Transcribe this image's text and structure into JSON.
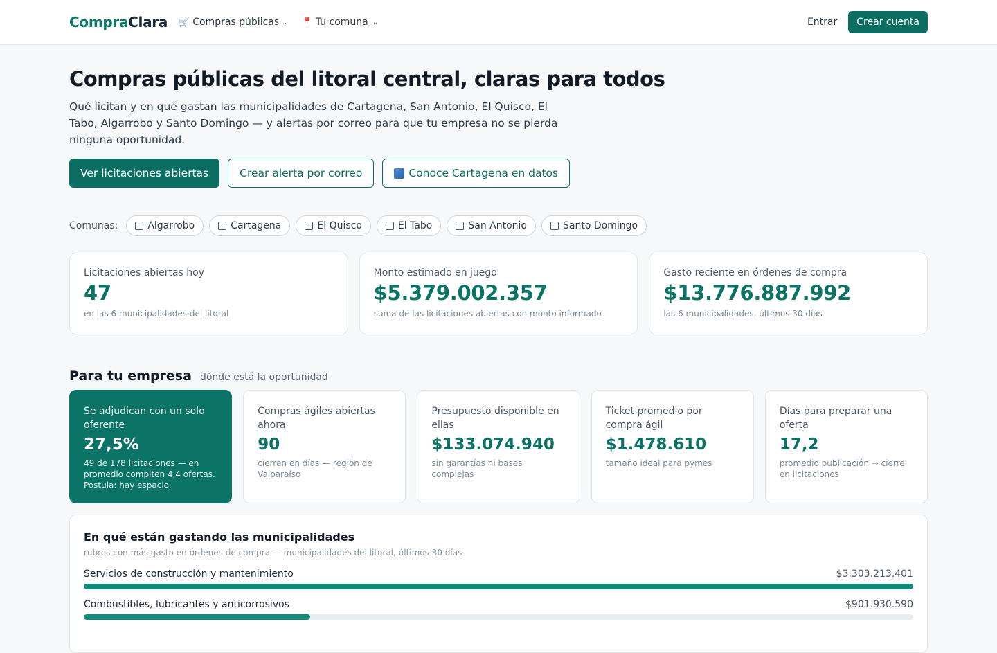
{
  "brand": {
    "part1": "Compra",
    "part2": "Clara"
  },
  "nav": {
    "compras": {
      "icon": "cart-icon",
      "label": "Compras públicas"
    },
    "comuna": {
      "icon": "pin-icon",
      "label": "Tu comuna"
    },
    "login": "Entrar",
    "signup": "Crear cuenta"
  },
  "hero": {
    "title": "Compras públicas del litoral central, claras para todos",
    "subtitle": "Qué licitan y en qué gastan las municipalidades de Cartagena, San Antonio, El Quisco, El Tabo, Algarrobo y Santo Domingo — y alertas por correo para que tu empresa no se pierda ninguna oportunidad.",
    "btn_primary": "Ver licitaciones abiertas",
    "btn_alert": "Crear alerta por correo",
    "btn_datos": "Conoce Cartagena en datos"
  },
  "comunas": {
    "label": "Comunas:",
    "items": [
      "Algarrobo",
      "Cartagena",
      "El Quisco",
      "El Tabo",
      "San Antonio",
      "Santo Domingo"
    ]
  },
  "stats": [
    {
      "label": "Licitaciones abiertas hoy",
      "value": "47",
      "note": "en las 6 municipalidades del litoral"
    },
    {
      "label": "Monto estimado en juego",
      "value": "$5.379.002.357",
      "note": "suma de las licitaciones abiertas con monto informado"
    },
    {
      "label": "Gasto reciente en órdenes de compra",
      "value": "$13.776.887.992",
      "note": "las 6 municipalidades, últimos 30 días"
    }
  ],
  "empresa": {
    "title": "Para tu empresa",
    "subtitle": "dónde está la oportunidad",
    "cards": [
      {
        "label": "Se adjudican con un solo oferente",
        "value": "27,5%",
        "note": "49 de 178 licitaciones — en promedio compiten 4,4 ofertas. Postula: hay espacio."
      },
      {
        "label": "Compras ágiles abiertas ahora",
        "value": "90",
        "note": "cierran en días — región de Valparaíso"
      },
      {
        "label": "Presupuesto disponible en ellas",
        "value": "$133.074.940",
        "note": "sin garantías ni bases complejas"
      },
      {
        "label": "Ticket promedio por compra ágil",
        "value": "$1.478.610",
        "note": "tamaño ideal para pymes"
      },
      {
        "label": "Días para preparar una oferta",
        "value": "17,2",
        "note": "promedio publicación → cierre en licitaciones"
      }
    ]
  },
  "gasto": {
    "title": "En qué están gastando las municipalidades",
    "subtitle": "rubros con más gasto en órdenes de compra — municipalidades del litoral, últimos 30 días",
    "rows": [
      {
        "label": "Servicios de construcción y mantenimiento",
        "amount": "$3.303.213.401",
        "fraction": 1.0
      },
      {
        "label": "Combustibles, lubricantes y anticorrosivos",
        "amount": "$901.930.590",
        "fraction": 0.273
      }
    ]
  },
  "colors": {
    "brand": "#0c6e62",
    "accent_value": "#0b7366",
    "highlight_card": "#0c7467"
  }
}
